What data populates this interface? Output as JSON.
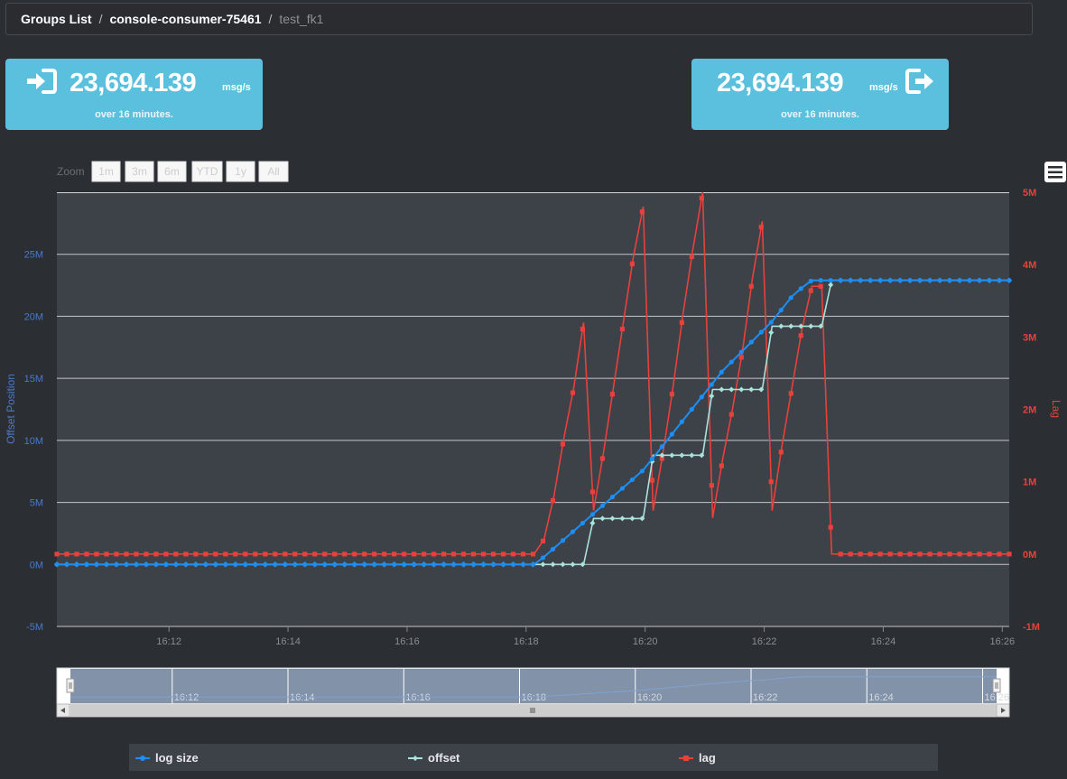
{
  "breadcrumb": {
    "items": [
      "Groups List",
      "console-consumer-75461"
    ],
    "current": "test_fk1",
    "separator": "/"
  },
  "stats": {
    "incoming": {
      "value": "23,694.139",
      "unit": "msg/s",
      "note": "over 16 minutes.",
      "icon": "sign-in-icon"
    },
    "outgoing": {
      "value": "23,694.139",
      "unit": "msg/s",
      "note": "over 16 minutes.",
      "icon": "sign-out-icon"
    }
  },
  "zoom": {
    "label": "Zoom",
    "buttons": [
      "1m",
      "3m",
      "6m",
      "YTD",
      "1y",
      "All"
    ]
  },
  "menu": {
    "icon": "hamburger-menu-icon"
  },
  "colors": {
    "log_size": "#1c8ff5",
    "offset": "#a8e3da",
    "lag": "#e8413c",
    "left_axis": "#4d79c7",
    "right_axis": "#e8413c",
    "stat_bg": "#5bc0de"
  },
  "chart_data": {
    "type": "line",
    "xlabel": "",
    "x_ticks": [
      "16:12",
      "16:14",
      "16:16",
      "16:18",
      "16:20",
      "16:22",
      "16:24",
      "16:26"
    ],
    "x_range": [
      "16:10:07",
      "16:26:07"
    ],
    "y_left": {
      "label": "Offset Position",
      "ticks": [
        "25M",
        "20M",
        "15M",
        "10M",
        "5M",
        "0M",
        "-5M"
      ],
      "ylim": [
        -5,
        30
      ],
      "unit": "M"
    },
    "y_right": {
      "label": "Lag",
      "ticks": [
        "5M",
        "4M",
        "3M",
        "2M",
        "1M",
        "0M",
        "-1M"
      ],
      "ylim": [
        -1,
        5
      ],
      "unit": "M"
    },
    "series": [
      {
        "name": "log size",
        "axis": "left",
        "marker": "circle",
        "x": [
          "16:10:07",
          "16:18:08",
          "16:18:18",
          "16:18:28",
          "16:18:38",
          "16:18:48",
          "16:18:58",
          "16:19:08",
          "16:19:18",
          "16:19:28",
          "16:19:38",
          "16:19:48",
          "16:19:58",
          "16:20:08",
          "16:20:18",
          "16:20:28",
          "16:20:38",
          "16:20:48",
          "16:20:58",
          "16:21:08",
          "16:21:18",
          "16:21:28",
          "16:21:38",
          "16:21:48",
          "16:21:58",
          "16:22:08",
          "16:22:18",
          "16:22:28",
          "16:22:38",
          "16:22:48",
          "16:22:58",
          "16:26:07"
        ],
        "y": [
          0,
          0,
          0.6,
          1.3,
          2.0,
          2.7,
          3.4,
          4.1,
          4.8,
          5.5,
          6.2,
          6.9,
          7.6,
          8.6,
          9.6,
          10.6,
          11.6,
          12.6,
          13.6,
          14.6,
          15.6,
          16.4,
          17.2,
          18.0,
          18.8,
          19.6,
          20.6,
          21.6,
          22.3,
          22.9,
          22.9,
          22.9
        ]
      },
      {
        "name": "offset",
        "axis": "left",
        "marker": "diamond",
        "x": [
          "16:10:07",
          "16:18:08",
          "16:18:58",
          "16:19:08",
          "16:19:58",
          "16:20:08",
          "16:20:58",
          "16:21:08",
          "16:21:58",
          "16:22:08",
          "16:22:58",
          "16:23:08",
          "16:26:07"
        ],
        "y": [
          0,
          0,
          0,
          3.7,
          3.7,
          8.8,
          8.8,
          14.1,
          14.1,
          19.2,
          19.2,
          22.9,
          22.9
        ]
      },
      {
        "name": "lag",
        "axis": "right",
        "marker": "square",
        "x": [
          "16:10:07",
          "16:18:08",
          "16:18:18",
          "16:18:28",
          "16:18:38",
          "16:18:48",
          "16:18:58",
          "16:19:08",
          "16:19:18",
          "16:19:28",
          "16:19:38",
          "16:19:48",
          "16:19:58",
          "16:20:08",
          "16:20:18",
          "16:20:28",
          "16:20:38",
          "16:20:48",
          "16:20:58",
          "16:21:08",
          "16:21:18",
          "16:21:28",
          "16:21:38",
          "16:21:48",
          "16:21:58",
          "16:22:08",
          "16:22:18",
          "16:22:28",
          "16:22:38",
          "16:22:48",
          "16:22:58",
          "16:23:08",
          "16:26:07"
        ],
        "y": [
          0,
          0,
          0.2,
          0.8,
          1.6,
          2.3,
          3.2,
          0.6,
          1.4,
          2.3,
          3.2,
          4.1,
          4.8,
          0.6,
          1.4,
          2.3,
          3.3,
          4.2,
          5.0,
          0.5,
          1.3,
          2.0,
          2.8,
          3.8,
          4.6,
          0.6,
          1.5,
          2.3,
          3.1,
          3.7,
          3.7,
          0,
          0
        ]
      }
    ],
    "navigator": {
      "x_ticks": [
        "16:12",
        "16:14",
        "16:16",
        "16:18",
        "16:20",
        "16:22",
        "16:24",
        "16:26"
      ]
    },
    "legend": {
      "placement": "bottom",
      "items": [
        "log size",
        "offset",
        "lag"
      ]
    }
  }
}
